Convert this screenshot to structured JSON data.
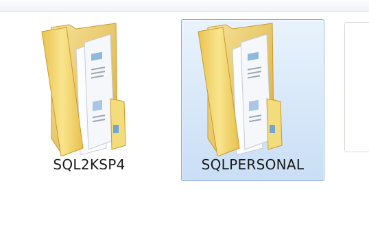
{
  "window": {
    "view_mode": "large-icons"
  },
  "items": [
    {
      "label": "SQL2KSP4",
      "icon": "folder-icon",
      "selected": false
    },
    {
      "label": "SQLPERSONAL",
      "icon": "folder-icon",
      "selected": true
    }
  ],
  "colors": {
    "folder_front": "#f2d76a",
    "folder_back": "#e9c553",
    "selection_fill": "#cfe3f8",
    "selection_border": "#84acdd"
  }
}
